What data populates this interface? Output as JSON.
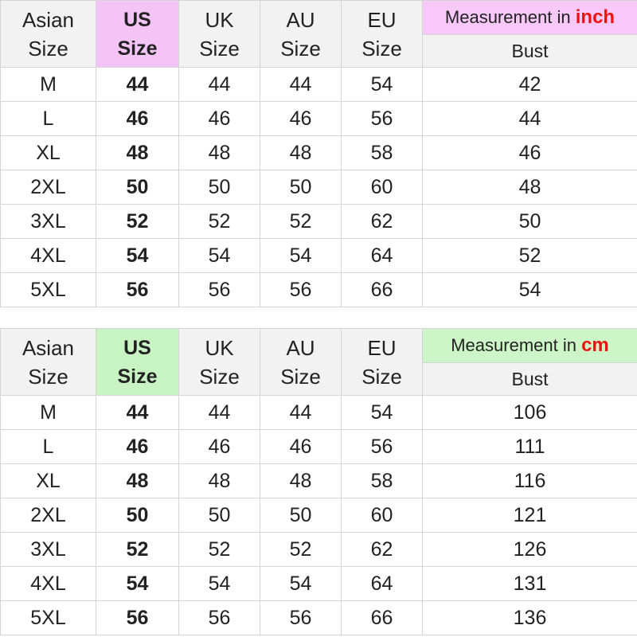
{
  "tables": [
    {
      "header": {
        "asian_line1": "Asian",
        "asian_line2": "Size",
        "us_line1": "US",
        "us_line2": "Size",
        "uk_line1": "UK",
        "uk_line2": "Size",
        "au_line1": "AU",
        "au_line2": "Size",
        "eu_line1": "EU",
        "eu_line2": "Size",
        "measurement_prefix": "Measurement in ",
        "measurement_unit": "inch",
        "bust": "Bust"
      },
      "highlight_color": "#f4c4f6",
      "rows": [
        {
          "asian": "M",
          "us": "44",
          "uk": "44",
          "au": "44",
          "eu": "54",
          "bust": "42"
        },
        {
          "asian": "L",
          "us": "46",
          "uk": "46",
          "au": "46",
          "eu": "56",
          "bust": "44"
        },
        {
          "asian": "XL",
          "us": "48",
          "uk": "48",
          "au": "48",
          "eu": "58",
          "bust": "46"
        },
        {
          "asian": "2XL",
          "us": "50",
          "uk": "50",
          "au": "50",
          "eu": "60",
          "bust": "48"
        },
        {
          "asian": "3XL",
          "us": "52",
          "uk": "52",
          "au": "52",
          "eu": "62",
          "bust": "50"
        },
        {
          "asian": "4XL",
          "us": "54",
          "uk": "54",
          "au": "54",
          "eu": "64",
          "bust": "52"
        },
        {
          "asian": "5XL",
          "us": "56",
          "uk": "56",
          "au": "56",
          "eu": "66",
          "bust": "54"
        }
      ]
    },
    {
      "header": {
        "asian_line1": "Asian",
        "asian_line2": "Size",
        "us_line1": "US",
        "us_line2": "Size",
        "uk_line1": "UK",
        "uk_line2": "Size",
        "au_line1": "AU",
        "au_line2": "Size",
        "eu_line1": "EU",
        "eu_line2": "Size",
        "measurement_prefix": "Measurement in ",
        "measurement_unit": "cm",
        "bust": "Bust"
      },
      "highlight_color": "#c8f4c4",
      "rows": [
        {
          "asian": "M",
          "us": "44",
          "uk": "44",
          "au": "44",
          "eu": "54",
          "bust": "106"
        },
        {
          "asian": "L",
          "us": "46",
          "uk": "46",
          "au": "46",
          "eu": "56",
          "bust": "111"
        },
        {
          "asian": "XL",
          "us": "48",
          "uk": "48",
          "au": "48",
          "eu": "58",
          "bust": "116"
        },
        {
          "asian": "2XL",
          "us": "50",
          "uk": "50",
          "au": "50",
          "eu": "60",
          "bust": "121"
        },
        {
          "asian": "3XL",
          "us": "52",
          "uk": "52",
          "au": "52",
          "eu": "62",
          "bust": "126"
        },
        {
          "asian": "4XL",
          "us": "54",
          "uk": "54",
          "au": "54",
          "eu": "64",
          "bust": "131"
        },
        {
          "asian": "5XL",
          "us": "56",
          "uk": "56",
          "au": "56",
          "eu": "66",
          "bust": "136"
        }
      ]
    }
  ],
  "colors": {
    "measurement_unit": "#ee1111",
    "header_bg": "#f2f2f2",
    "border": "#d4d4d4"
  }
}
